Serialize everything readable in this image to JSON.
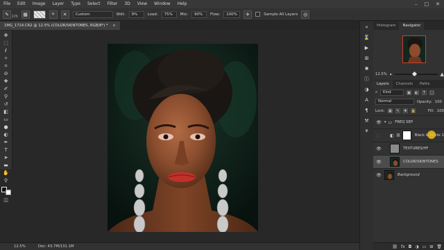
{
  "menu": {
    "items": [
      "File",
      "Edit",
      "Image",
      "Layer",
      "Type",
      "Select",
      "Filter",
      "3D",
      "View",
      "Window",
      "Help"
    ],
    "window_controls": [
      "–",
      "□",
      "✕"
    ]
  },
  "options": {
    "brush_size": "175",
    "mode_value": "Custom",
    "width_label": "Wdt:",
    "width_value": "9%",
    "load_label": "Load:",
    "load_value": "75%",
    "mix_label": "Mix:",
    "mix_value": "90%",
    "flow_label": "Flow:",
    "flow_value": "100%",
    "sample_all_label": "Sample All Layers"
  },
  "document": {
    "tab_title": "1MG_1714.CR2 @ 12.5% (COLOR/SKINTONES, RGB/8*) *",
    "close": "×"
  },
  "status": {
    "zoom": "12.5%",
    "doc_info": "Doc: 43.7M/131.1M"
  },
  "navigator": {
    "tabs": [
      "Histogram",
      "Navigator"
    ],
    "active_tab": "Navigator",
    "zoom": "12.5%"
  },
  "layers_panel": {
    "tabs": [
      "Layers",
      "Channels",
      "Paths"
    ],
    "active_tab": "Layers",
    "filter_label": "Kind",
    "blend_mode": "Normal",
    "opacity_label": "Opacity:",
    "opacity_value": "100",
    "lock_label": "Lock:",
    "fill_label": "Fill:",
    "fill_value": "100",
    "layers": [
      {
        "name": "FREQ SEP",
        "type": "group"
      },
      {
        "name": "Black & White 1",
        "type": "adjustment"
      },
      {
        "name": "TEXTURES/HF",
        "type": "normal"
      },
      {
        "name": "COLOR/SKINTONES",
        "type": "normal",
        "selected": true
      },
      {
        "name": "Background",
        "type": "background"
      }
    ]
  },
  "colors": {
    "menubar": "#383838",
    "panel": "#323232",
    "canvas": "#282828",
    "selected_layer": "#4c4c4c",
    "nav_box": "#d23a2e"
  }
}
